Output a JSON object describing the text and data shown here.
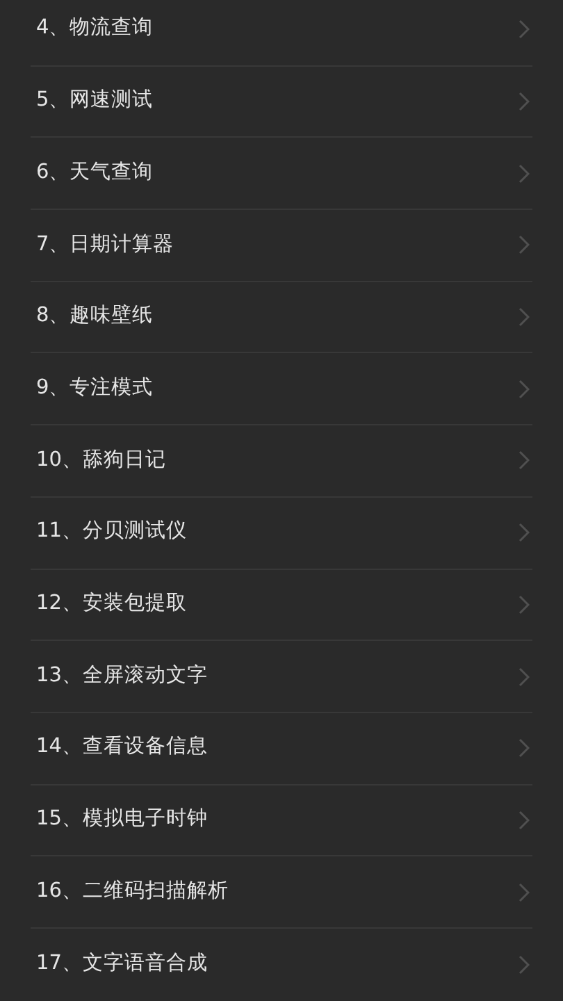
{
  "items": [
    {
      "label": "4、物流查询"
    },
    {
      "label": "5、网速测试"
    },
    {
      "label": "6、天气查询"
    },
    {
      "label": "7、日期计算器"
    },
    {
      "label": "8、趣味壁纸"
    },
    {
      "label": "9、专注模式"
    },
    {
      "label": "10、舔狗日记"
    },
    {
      "label": "11、分贝测试仪"
    },
    {
      "label": "12、安装包提取"
    },
    {
      "label": "13、全屏滚动文字"
    },
    {
      "label": "14、查看设备信息"
    },
    {
      "label": "15、模拟电子时钟"
    },
    {
      "label": "16、二维码扫描解析"
    },
    {
      "label": "17、文字语音合成"
    }
  ]
}
